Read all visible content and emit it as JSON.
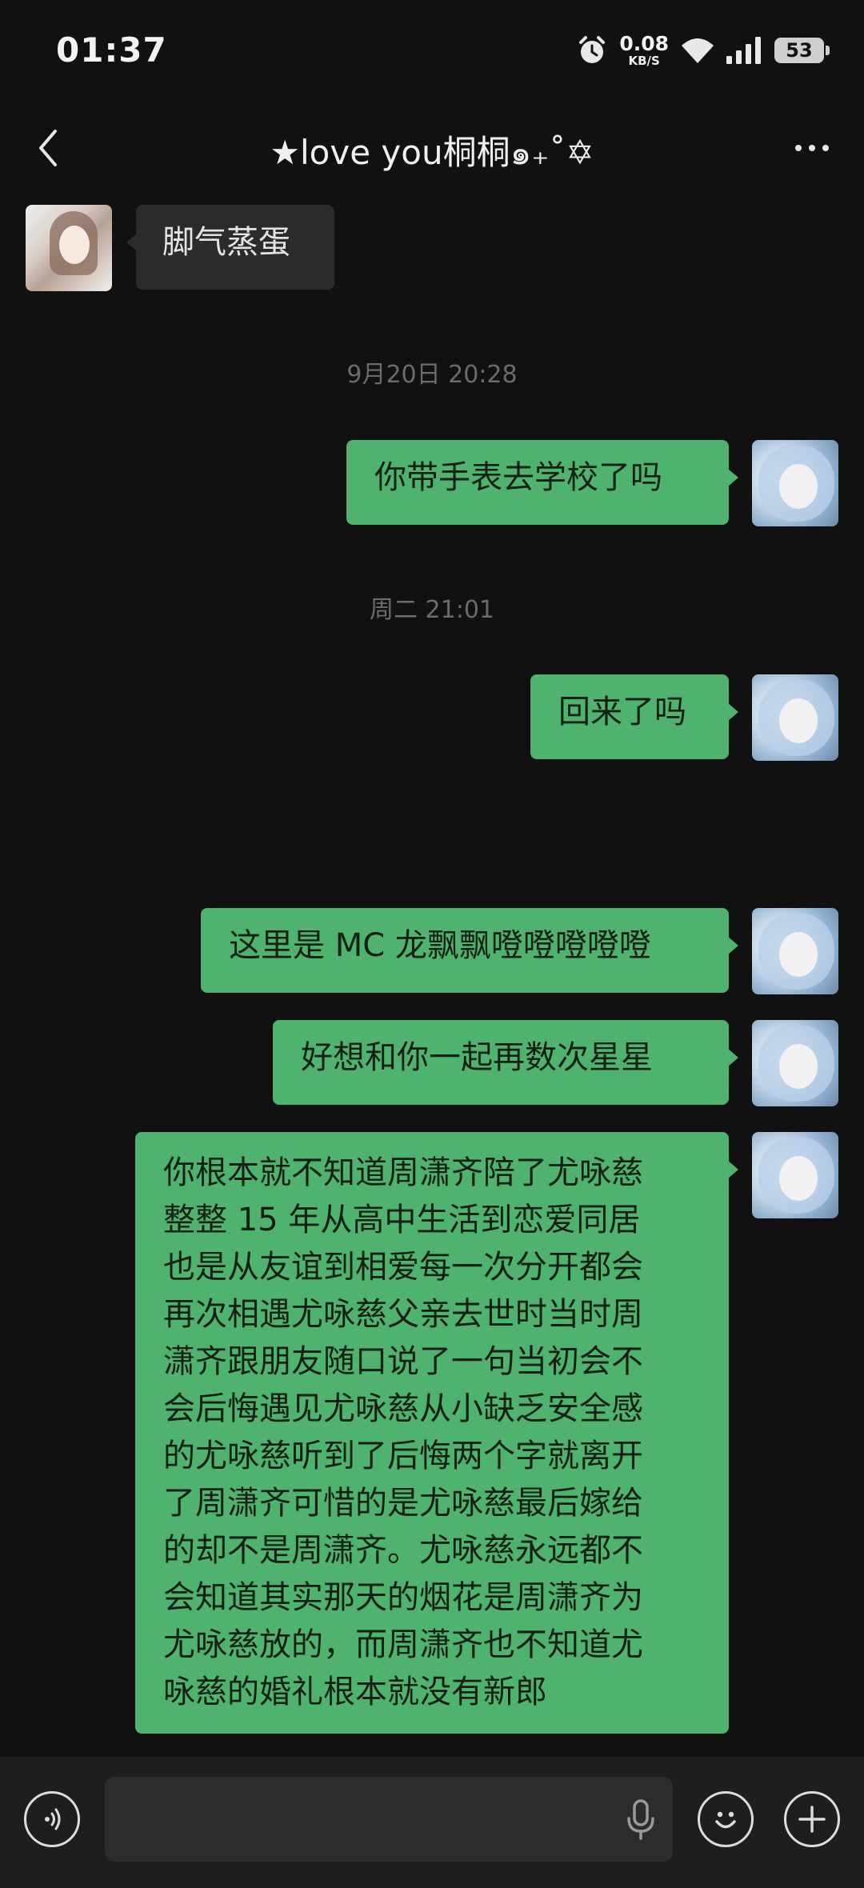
{
  "status_bar": {
    "time": "01:37",
    "net_speed": "0.08",
    "net_unit": "KB/S",
    "battery": "53"
  },
  "header": {
    "title": "★love you桐桐๑₊˚✡"
  },
  "messages": [
    {
      "text": "脚气蒸蛋"
    },
    {
      "timestamp": "9月20日 20:28"
    },
    {
      "text": "你带手表去学校了吗"
    },
    {
      "timestamp": "周二 21:01"
    },
    {
      "text": "回来了吗"
    },
    {
      "text": "这里是 MC 龙飘飘噔噔噔噔噔"
    },
    {
      "text": "好想和你一起再数次星星"
    },
    {
      "text": "你根本就不知道周潇齐陪了尤咏慈整整 15 年从高中生活到恋爱同居也是从友谊到相爱每一次分开都会再次相遇尤咏慈父亲去世时当时周潇齐跟朋友随口说了一句当初会不会后悔遇见尤咏慈从小缺乏安全感的尤咏慈听到了后悔两个字就离开了周潇齐可惜的是尤咏慈最后嫁给的却不是周潇齐。尤咏慈永远都不会知道其实那天的烟花是周潇齐为尤咏慈放的，而周潇齐也不知道尤咏慈的婚礼根本就没有新郎"
    }
  ],
  "long_message_lines": [
    "你根本就不知道周潇齐陪了尤咏慈",
    "整整 15 年从高中生活到恋爱同居",
    "也是从友谊到相爱每一次分开都会",
    "再次相遇尤咏慈父亲去世时当时周",
    "潇齐跟朋友随口说了一句当初会不",
    "会后悔遇见尤咏慈从小缺乏安全感",
    "的尤咏慈听到了后悔两个字就离开",
    "了周潇齐可惜的是尤咏慈最后嫁给",
    "的却不是周潇齐。尤咏慈永远都不",
    "会知道其实那天的烟花是周潇齐为",
    "尤咏慈放的，而周潇齐也不知道尤",
    "咏慈的婚礼根本就没有新郎"
  ],
  "icons": {
    "alarm": "alarm-icon",
    "wifi": "wifi-icon",
    "signal": "signal-icon",
    "back": "back-arrow-icon",
    "more": "more-icon",
    "voice": "voice-icon",
    "mic": "microphone-icon",
    "emoji": "emoji-icon",
    "plus": "plus-icon"
  },
  "colors": {
    "background": "#111111",
    "self_bubble": "#4fb36f",
    "other_bubble": "#2b2b2b",
    "input_bar": "#1e1e1e"
  }
}
